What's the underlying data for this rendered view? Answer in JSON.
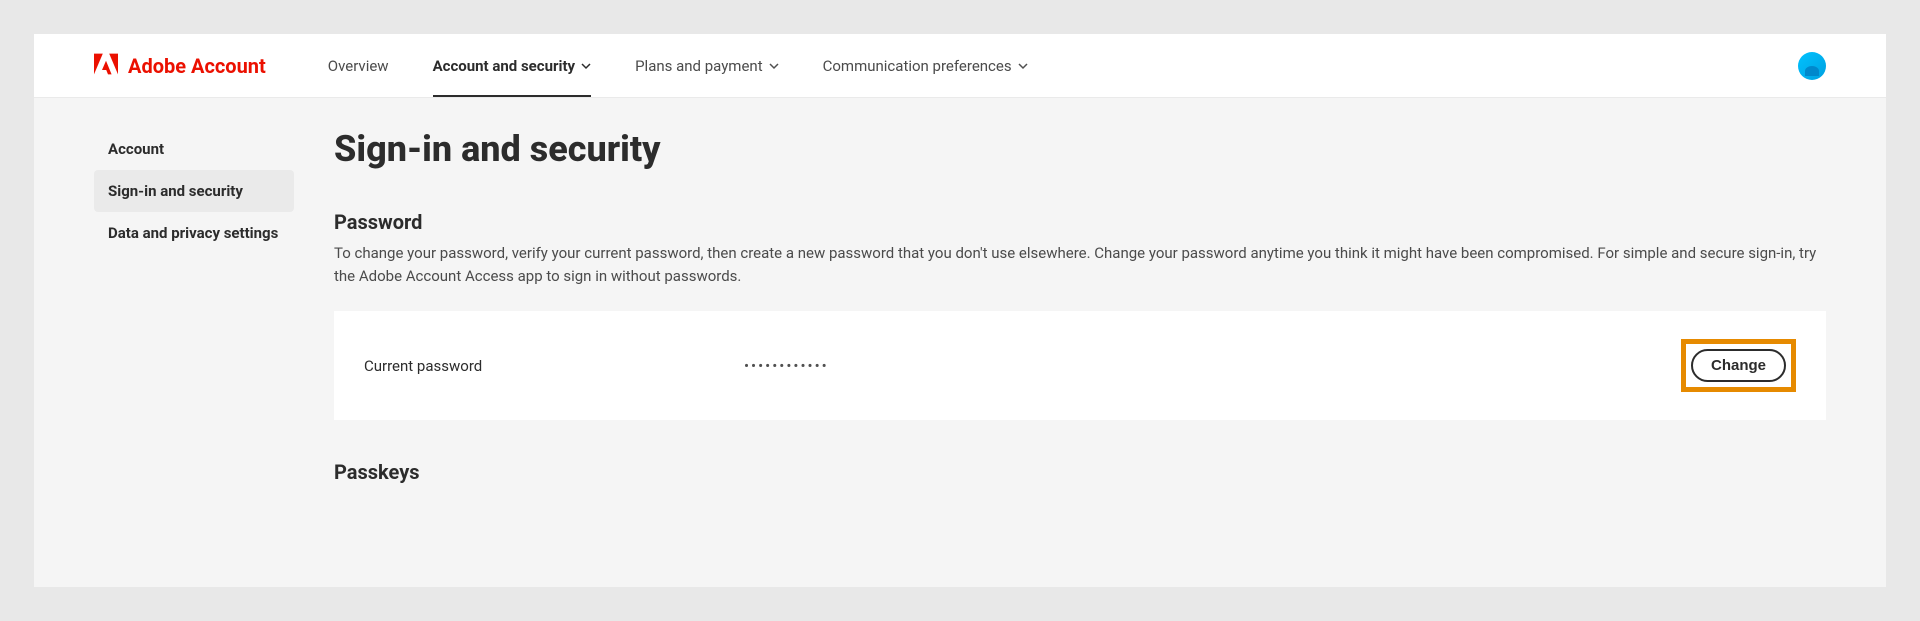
{
  "brand": {
    "name": "Adobe Account"
  },
  "nav": {
    "items": [
      {
        "label": "Overview",
        "hasChevron": false
      },
      {
        "label": "Account and security",
        "hasChevron": true,
        "active": true
      },
      {
        "label": "Plans and payment",
        "hasChevron": true
      },
      {
        "label": "Communication preferences",
        "hasChevron": true
      }
    ]
  },
  "sidebar": {
    "items": [
      {
        "label": "Account"
      },
      {
        "label": "Sign-in and security",
        "active": true
      },
      {
        "label": "Data and privacy settings"
      }
    ]
  },
  "page": {
    "title": "Sign-in and security"
  },
  "sections": {
    "password": {
      "title": "Password",
      "description": "To change your password, verify your current password, then create a new password that you don't use elsewhere. Change your password anytime you think it might have been compromised. For simple and secure sign-in, try the Adobe Account Access app to sign in without passwords.",
      "field_label": "Current password",
      "field_value": "••••••••••••",
      "change_button": "Change"
    },
    "passkeys": {
      "title": "Passkeys"
    }
  }
}
